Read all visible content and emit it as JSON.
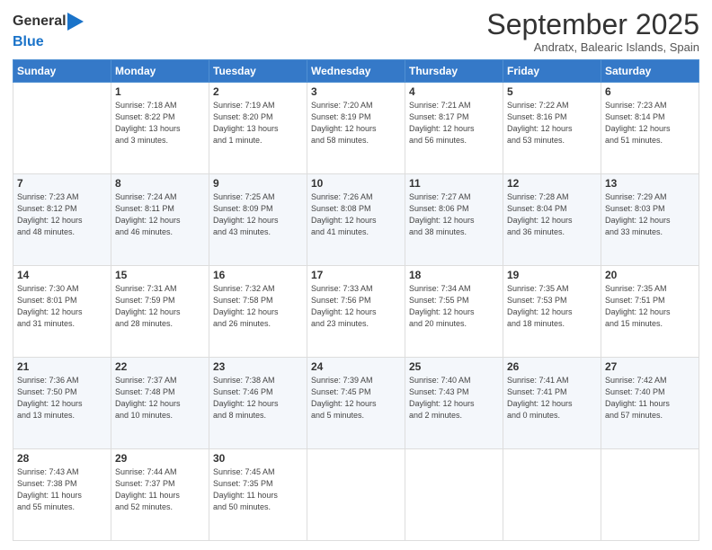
{
  "header": {
    "logo_line1": "General",
    "logo_line2": "Blue",
    "month": "September 2025",
    "location": "Andratx, Balearic Islands, Spain"
  },
  "days_of_week": [
    "Sunday",
    "Monday",
    "Tuesday",
    "Wednesday",
    "Thursday",
    "Friday",
    "Saturday"
  ],
  "weeks": [
    [
      {
        "day": "",
        "info": ""
      },
      {
        "day": "1",
        "info": "Sunrise: 7:18 AM\nSunset: 8:22 PM\nDaylight: 13 hours\nand 3 minutes."
      },
      {
        "day": "2",
        "info": "Sunrise: 7:19 AM\nSunset: 8:20 PM\nDaylight: 13 hours\nand 1 minute."
      },
      {
        "day": "3",
        "info": "Sunrise: 7:20 AM\nSunset: 8:19 PM\nDaylight: 12 hours\nand 58 minutes."
      },
      {
        "day": "4",
        "info": "Sunrise: 7:21 AM\nSunset: 8:17 PM\nDaylight: 12 hours\nand 56 minutes."
      },
      {
        "day": "5",
        "info": "Sunrise: 7:22 AM\nSunset: 8:16 PM\nDaylight: 12 hours\nand 53 minutes."
      },
      {
        "day": "6",
        "info": "Sunrise: 7:23 AM\nSunset: 8:14 PM\nDaylight: 12 hours\nand 51 minutes."
      }
    ],
    [
      {
        "day": "7",
        "info": "Sunrise: 7:23 AM\nSunset: 8:12 PM\nDaylight: 12 hours\nand 48 minutes."
      },
      {
        "day": "8",
        "info": "Sunrise: 7:24 AM\nSunset: 8:11 PM\nDaylight: 12 hours\nand 46 minutes."
      },
      {
        "day": "9",
        "info": "Sunrise: 7:25 AM\nSunset: 8:09 PM\nDaylight: 12 hours\nand 43 minutes."
      },
      {
        "day": "10",
        "info": "Sunrise: 7:26 AM\nSunset: 8:08 PM\nDaylight: 12 hours\nand 41 minutes."
      },
      {
        "day": "11",
        "info": "Sunrise: 7:27 AM\nSunset: 8:06 PM\nDaylight: 12 hours\nand 38 minutes."
      },
      {
        "day": "12",
        "info": "Sunrise: 7:28 AM\nSunset: 8:04 PM\nDaylight: 12 hours\nand 36 minutes."
      },
      {
        "day": "13",
        "info": "Sunrise: 7:29 AM\nSunset: 8:03 PM\nDaylight: 12 hours\nand 33 minutes."
      }
    ],
    [
      {
        "day": "14",
        "info": "Sunrise: 7:30 AM\nSunset: 8:01 PM\nDaylight: 12 hours\nand 31 minutes."
      },
      {
        "day": "15",
        "info": "Sunrise: 7:31 AM\nSunset: 7:59 PM\nDaylight: 12 hours\nand 28 minutes."
      },
      {
        "day": "16",
        "info": "Sunrise: 7:32 AM\nSunset: 7:58 PM\nDaylight: 12 hours\nand 26 minutes."
      },
      {
        "day": "17",
        "info": "Sunrise: 7:33 AM\nSunset: 7:56 PM\nDaylight: 12 hours\nand 23 minutes."
      },
      {
        "day": "18",
        "info": "Sunrise: 7:34 AM\nSunset: 7:55 PM\nDaylight: 12 hours\nand 20 minutes."
      },
      {
        "day": "19",
        "info": "Sunrise: 7:35 AM\nSunset: 7:53 PM\nDaylight: 12 hours\nand 18 minutes."
      },
      {
        "day": "20",
        "info": "Sunrise: 7:35 AM\nSunset: 7:51 PM\nDaylight: 12 hours\nand 15 minutes."
      }
    ],
    [
      {
        "day": "21",
        "info": "Sunrise: 7:36 AM\nSunset: 7:50 PM\nDaylight: 12 hours\nand 13 minutes."
      },
      {
        "day": "22",
        "info": "Sunrise: 7:37 AM\nSunset: 7:48 PM\nDaylight: 12 hours\nand 10 minutes."
      },
      {
        "day": "23",
        "info": "Sunrise: 7:38 AM\nSunset: 7:46 PM\nDaylight: 12 hours\nand 8 minutes."
      },
      {
        "day": "24",
        "info": "Sunrise: 7:39 AM\nSunset: 7:45 PM\nDaylight: 12 hours\nand 5 minutes."
      },
      {
        "day": "25",
        "info": "Sunrise: 7:40 AM\nSunset: 7:43 PM\nDaylight: 12 hours\nand 2 minutes."
      },
      {
        "day": "26",
        "info": "Sunrise: 7:41 AM\nSunset: 7:41 PM\nDaylight: 12 hours\nand 0 minutes."
      },
      {
        "day": "27",
        "info": "Sunrise: 7:42 AM\nSunset: 7:40 PM\nDaylight: 11 hours\nand 57 minutes."
      }
    ],
    [
      {
        "day": "28",
        "info": "Sunrise: 7:43 AM\nSunset: 7:38 PM\nDaylight: 11 hours\nand 55 minutes."
      },
      {
        "day": "29",
        "info": "Sunrise: 7:44 AM\nSunset: 7:37 PM\nDaylight: 11 hours\nand 52 minutes."
      },
      {
        "day": "30",
        "info": "Sunrise: 7:45 AM\nSunset: 7:35 PM\nDaylight: 11 hours\nand 50 minutes."
      },
      {
        "day": "",
        "info": ""
      },
      {
        "day": "",
        "info": ""
      },
      {
        "day": "",
        "info": ""
      },
      {
        "day": "",
        "info": ""
      }
    ]
  ]
}
